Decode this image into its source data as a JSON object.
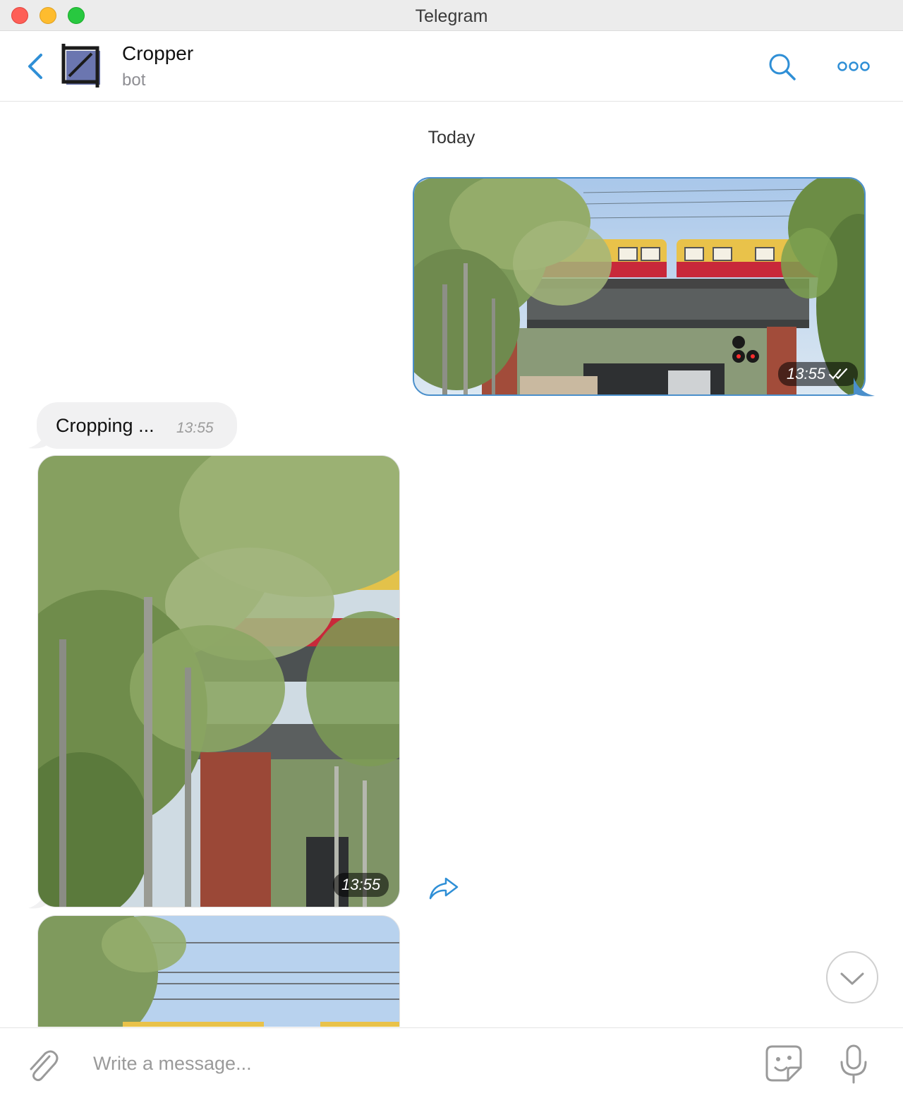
{
  "window": {
    "title": "Telegram"
  },
  "chat": {
    "name": "Cropper",
    "status": "bot"
  },
  "messages": {
    "date_separator": "Today",
    "outgoing_photo": {
      "time": "13:55"
    },
    "incoming_text": {
      "text": "Cropping ...",
      "time": "13:55"
    },
    "incoming_photo": {
      "time": "13:55"
    }
  },
  "composer": {
    "placeholder": "Write a message..."
  },
  "icons": {
    "back": "chevron-left-icon",
    "avatar": "crop-icon",
    "search": "search-icon",
    "more": "more-icon",
    "read_status": "double-check-icon",
    "forward": "forward-icon",
    "scroll_down": "chevron-down-icon",
    "attach": "paperclip-icon",
    "sticker": "sticker-icon",
    "mic": "microphone-icon"
  },
  "colors": {
    "accent": "#2f8fd6",
    "outgoing_border": "#4a8fcb",
    "incoming_bubble": "#f1f1f2"
  }
}
